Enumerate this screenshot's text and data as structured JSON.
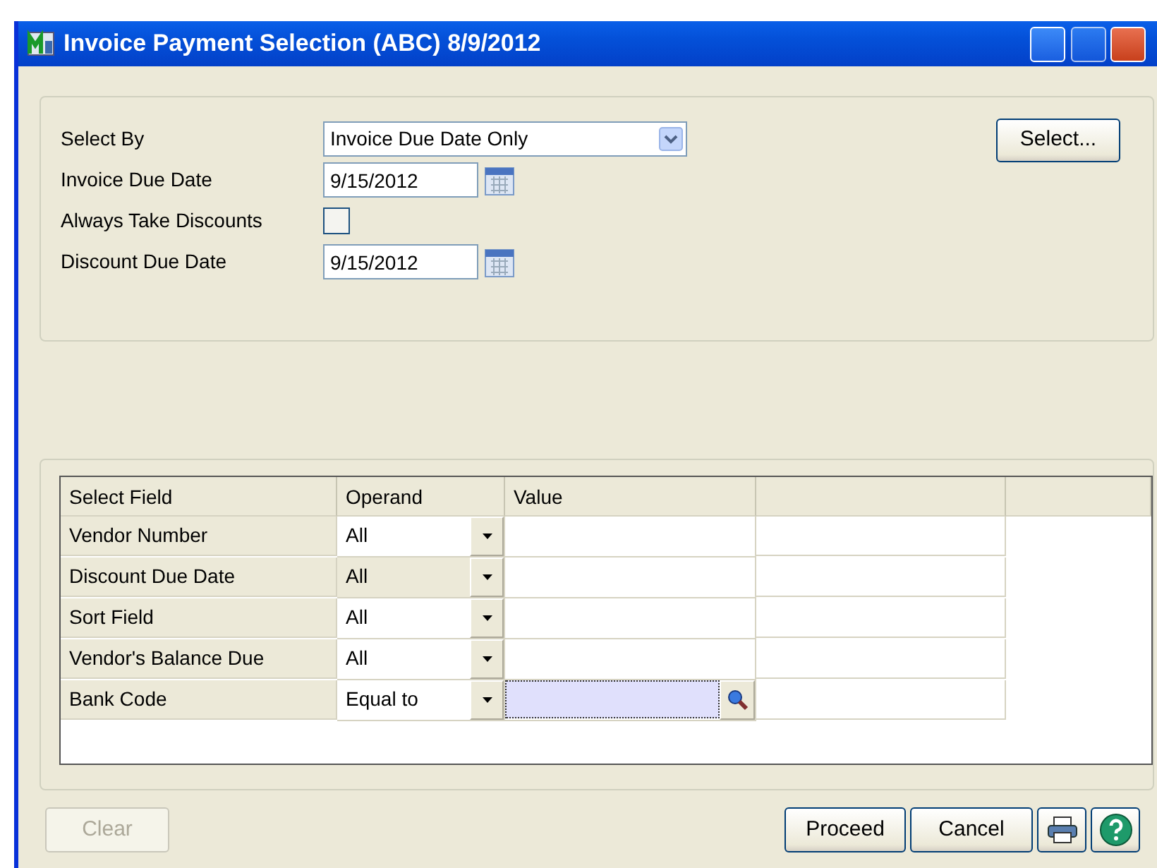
{
  "window": {
    "title": "Invoice Payment Selection (ABC) 8/9/2012"
  },
  "form": {
    "select_by": {
      "label": "Select By",
      "value": "Invoice Due Date Only"
    },
    "invoice_due_date": {
      "label": "Invoice Due Date",
      "value": "9/15/2012"
    },
    "always_take_discounts": {
      "label": "Always Take Discounts",
      "checked": false
    },
    "discount_due_date": {
      "label": "Discount Due Date",
      "value": "9/15/2012"
    },
    "select_button": "Select..."
  },
  "grid": {
    "columns": [
      "Select Field",
      "Operand",
      "Value"
    ],
    "rows": [
      {
        "field": "Vendor Number",
        "operand": "All",
        "selected": false,
        "focused": false
      },
      {
        "field": "Discount Due Date",
        "operand": "All",
        "selected": true,
        "focused": false
      },
      {
        "field": "Sort Field",
        "operand": "All",
        "selected": false,
        "focused": false
      },
      {
        "field": "Vendor's Balance Due",
        "operand": "All",
        "selected": false,
        "focused": false
      },
      {
        "field": "Bank Code",
        "operand": "Equal to",
        "selected": false,
        "focused": true
      }
    ]
  },
  "buttons": {
    "clear": {
      "label": "Clear",
      "disabled": true
    },
    "proceed": "Proceed",
    "cancel": "Cancel"
  }
}
